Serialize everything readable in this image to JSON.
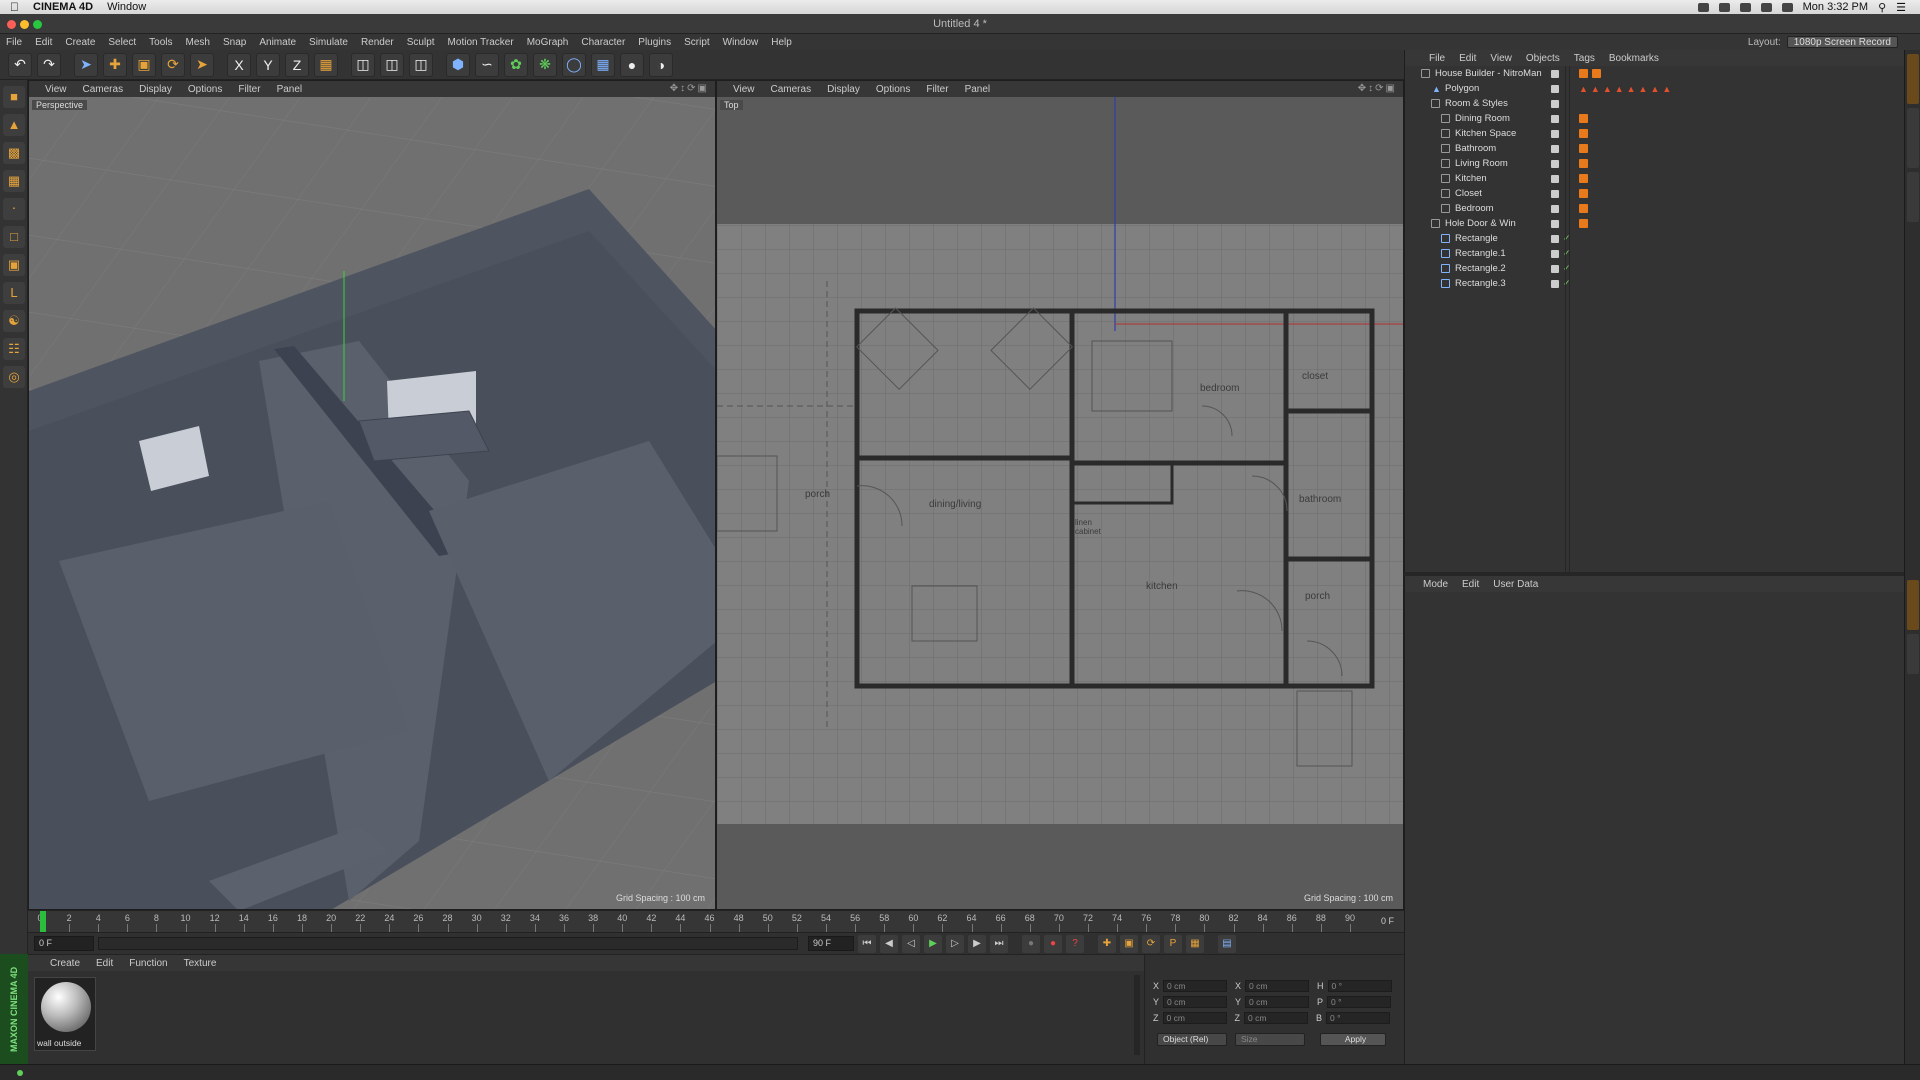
{
  "macbar": {
    "app": "CINEMA 4D",
    "menu": "Window",
    "clock": "Mon 3:32 PM"
  },
  "window": {
    "title": "Untitled 4 *"
  },
  "menu": [
    "File",
    "Edit",
    "Create",
    "Select",
    "Tools",
    "Mesh",
    "Snap",
    "Animate",
    "Simulate",
    "Render",
    "Sculpt",
    "Motion Tracker",
    "MoGraph",
    "Character",
    "Plugins",
    "Script",
    "Window",
    "Help"
  ],
  "layout": {
    "label": "Layout:",
    "value": "1080p Screen Record"
  },
  "viewport_menu": [
    "View",
    "Cameras",
    "Display",
    "Options",
    "Filter",
    "Panel"
  ],
  "viewport_left": {
    "label": "Perspective",
    "grid": "Grid Spacing : 100 cm"
  },
  "viewport_right": {
    "label": "Top",
    "grid": "Grid Spacing : 100 cm"
  },
  "floorplan": {
    "rooms": [
      "bedroom",
      "closet",
      "porch",
      "dining/living",
      "bathroom",
      "kitchen",
      "porch"
    ],
    "cabinet": "linen cabinet"
  },
  "object_manager": {
    "menu": [
      "File",
      "Edit",
      "View",
      "Objects",
      "Tags",
      "Bookmarks"
    ],
    "items": [
      {
        "name": "House Builder - NitroMan",
        "level": 0
      },
      {
        "name": "Polygon",
        "level": 1
      },
      {
        "name": "Room & Styles",
        "level": 1
      },
      {
        "name": "Dining Room",
        "level": 2
      },
      {
        "name": "Kitchen Space",
        "level": 2
      },
      {
        "name": "Bathroom",
        "level": 2
      },
      {
        "name": "Living Room",
        "level": 2
      },
      {
        "name": "Kitchen",
        "level": 2
      },
      {
        "name": "Closet",
        "level": 2
      },
      {
        "name": "Bedroom",
        "level": 2
      },
      {
        "name": "Hole Door & Win",
        "level": 1
      },
      {
        "name": "Rectangle",
        "level": 2
      },
      {
        "name": "Rectangle.1",
        "level": 2
      },
      {
        "name": "Rectangle.2",
        "level": 2
      },
      {
        "name": "Rectangle.3",
        "level": 2
      }
    ]
  },
  "attributes": {
    "menu": [
      "Mode",
      "Edit",
      "User Data"
    ]
  },
  "timeline": {
    "ticks": [
      "0",
      "2",
      "4",
      "6",
      "8",
      "10",
      "12",
      "14",
      "16",
      "18",
      "20",
      "22",
      "24",
      "26",
      "28",
      "30",
      "32",
      "34",
      "36",
      "38",
      "40",
      "42",
      "44",
      "46",
      "48",
      "50",
      "52",
      "54",
      "56",
      "58",
      "60",
      "62",
      "64",
      "66",
      "68",
      "70",
      "72",
      "74",
      "76",
      "78",
      "80",
      "82",
      "84",
      "86",
      "88",
      "90"
    ],
    "end": "0 F",
    "start_field": "0 F",
    "end_field": "90 F",
    "range_end": "90 F"
  },
  "material_manager": {
    "menu": [
      "Create",
      "Edit",
      "Function",
      "Texture"
    ],
    "material": "wall outside"
  },
  "coordinates": {
    "rows": [
      {
        "a": "X",
        "av": "0 cm",
        "b": "X",
        "bv": "0 cm",
        "c": "H",
        "cv": "0 °"
      },
      {
        "a": "Y",
        "av": "0 cm",
        "b": "Y",
        "bv": "0 cm",
        "c": "P",
        "cv": "0 °"
      },
      {
        "a": "Z",
        "av": "0 cm",
        "b": "Z",
        "bv": "0 cm",
        "c": "B",
        "cv": "0 °"
      }
    ],
    "mode": "Object (Rel)",
    "size": "Size",
    "apply": "Apply"
  },
  "maxon": "MAXON CINEMA 4D"
}
